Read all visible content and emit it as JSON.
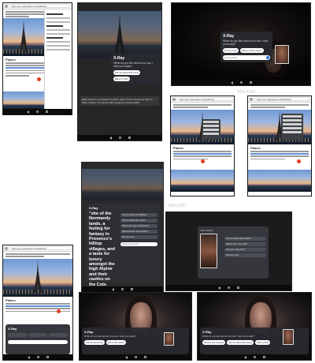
{
  "screens": {
    "s1": {
      "url": "https://en.wikipedia.org/wiki/Paris",
      "heading": "Places",
      "panel_title": "Reading"
    },
    "s2": {
      "xray_title": "X-Ray",
      "xray_sub": "What do you like about\nhow can I help you today?",
      "chips": [
        "Tell me about this movie",
        "Who's in this?"
      ],
      "caption": "Eiffel Tower is a wrought-iron lattice tower on the Champ de Mars in Paris, France. It is named after engineer Gustave Eiffel."
    },
    "s3": {
      "xray_title": "X-Ray",
      "xray_sub": "What do you like about\nhow can I help you today?",
      "chips": [
        "Tell me more",
        "Who's in this scene?"
      ],
      "input_placeholder": "Ask anything"
    },
    "s4": {
      "url": "https://en.wikipedia.org/wiki/Paris",
      "heading": "Places"
    },
    "s5": {
      "url": "https://en.wikipedia.org/wiki/Paris",
      "heading": "Places"
    },
    "s6": {
      "xray_title": "X-Ray",
      "quote": "\"she of the Normandy lands, a feeling for fantasy in Provence's hilltop villages, and a taste for luxury amongst the high Alpine and their castles on the Cote d'Azur.\"",
      "items": [
        "Tell me about the highest",
        "Tell me about the region",
        "Show me more of Provence",
        "What should I see nearby?",
        "Tell me more"
      ],
      "input_placeholder": "Message Gemini"
    },
    "s7": {
      "title": "Your clothes",
      "items": [
        "Tell me about this product",
        "Where can I buy this?",
        "How do I style this?",
        "Tell me more"
      ]
    },
    "s8": {
      "url": "https://en.wikipedia.org/wiki/Paris",
      "heading": "Places",
      "xray_title": "X-Ray"
    },
    "s9": {
      "xray_title": "X-Ray",
      "xray_sub": "What do you like about\nhow can I help you today?",
      "chips": [
        "Tell me about this",
        "Who's this actor?"
      ]
    },
    "s10": {
      "xray_title": "X-Ray",
      "xray_sub": "What do you like about\nhow can I help you today?",
      "chips": [
        "What is she wearing",
        "Tell me about this scene",
        "Who is this?"
      ]
    }
  },
  "labels": {
    "size_a": "800x1280",
    "size_b": "800x1000"
  },
  "colors": {
    "accent": "#e53b27",
    "link": "#5f8fd8",
    "panel": "#282a30"
  }
}
